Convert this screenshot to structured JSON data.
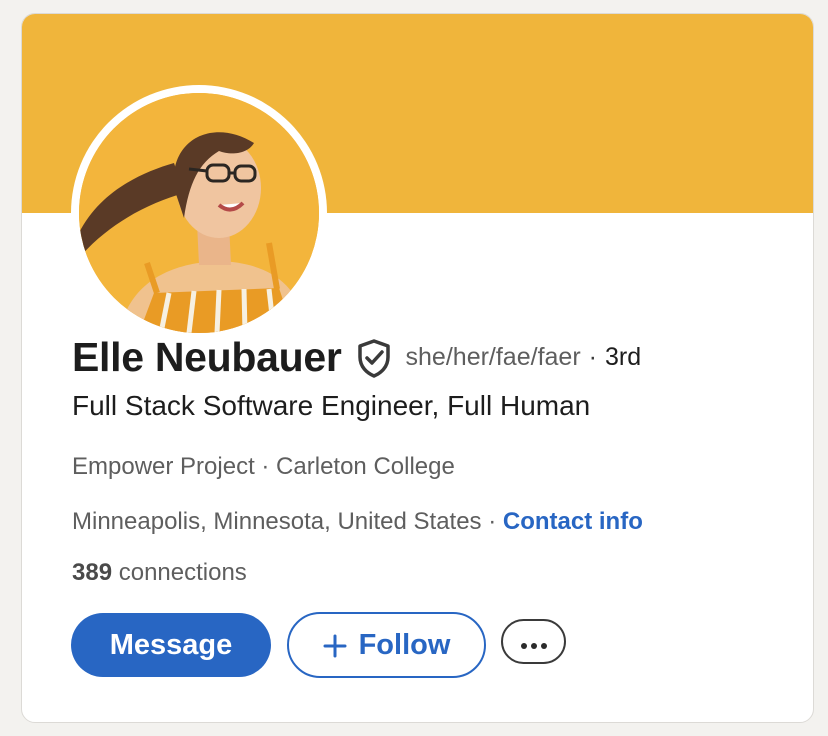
{
  "profile": {
    "name": "Elle Neubauer",
    "pronouns": "she/her/fae/faer",
    "separator": "·",
    "degree": "3rd",
    "headline": "Full Stack Software Engineer, Full Human",
    "organizations": "Empower Project · Carleton College",
    "location": "Minneapolis, Minnesota, United States",
    "location_separator": " · ",
    "contact_label": "Contact info",
    "connections_count": "389",
    "connections_label": " connections"
  },
  "actions": {
    "message_label": "Message",
    "follow_label": "Follow",
    "more_icon": "ellipsis-icon"
  },
  "colors": {
    "banner": "#f0b53b",
    "accent": "#2866c3"
  },
  "icons": {
    "verified": "shield-check-icon",
    "follow": "plus-icon"
  }
}
